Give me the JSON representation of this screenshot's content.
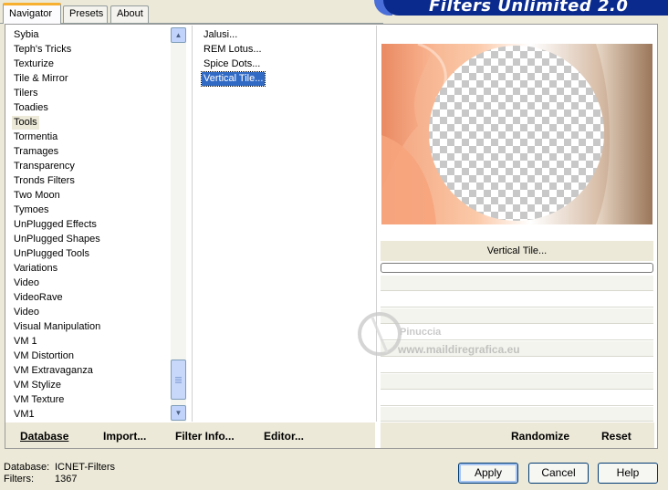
{
  "tabs": [
    "Navigator",
    "Presets",
    "About"
  ],
  "banner_title": "Filters Unlimited 2.0",
  "categories": [
    "Sybia",
    "Teph's Tricks",
    "Texturize",
    "Tile & Mirror",
    "Tilers",
    "Toadies",
    "Tools",
    "Tormentia",
    "Tramages",
    "Transparency",
    "Tronds Filters",
    "Two Moon",
    "Tymoes",
    "UnPlugged Effects",
    "UnPlugged Shapes",
    "UnPlugged Tools",
    "Variations",
    "Video",
    "VideoRave",
    "Video",
    "Visual Manipulation",
    "VM 1",
    "VM Distortion",
    "VM Extravaganza",
    "VM Stylize",
    "VM Texture",
    "VM1"
  ],
  "selected_category": "Tools",
  "filters": [
    "Jalusi...",
    "REM Lotus...",
    "Spice Dots...",
    "Vertical Tile..."
  ],
  "selected_filter": "Vertical Tile...",
  "preview_filter_name": "Vertical Tile...",
  "progress": 0,
  "watermark": {
    "line1": "Pinuccia",
    "line2": "www.maildiregrafica.eu"
  },
  "left_buttons": {
    "database": "Database",
    "import": "Import...",
    "filter_info": "Filter Info...",
    "editor": "Editor..."
  },
  "right_buttons": {
    "randomize": "Randomize",
    "reset": "Reset"
  },
  "status": {
    "database_label": "Database:",
    "database_value": "ICNET-Filters",
    "filters_label": "Filters:",
    "filters_value": "1367"
  },
  "dialog_buttons": {
    "apply": "Apply",
    "cancel": "Cancel",
    "help": "Help"
  },
  "colors": {
    "selection": "#316ac5",
    "banner": "#0a2a8e",
    "peach": "#f4a27a",
    "brown": "#a07a5c"
  }
}
